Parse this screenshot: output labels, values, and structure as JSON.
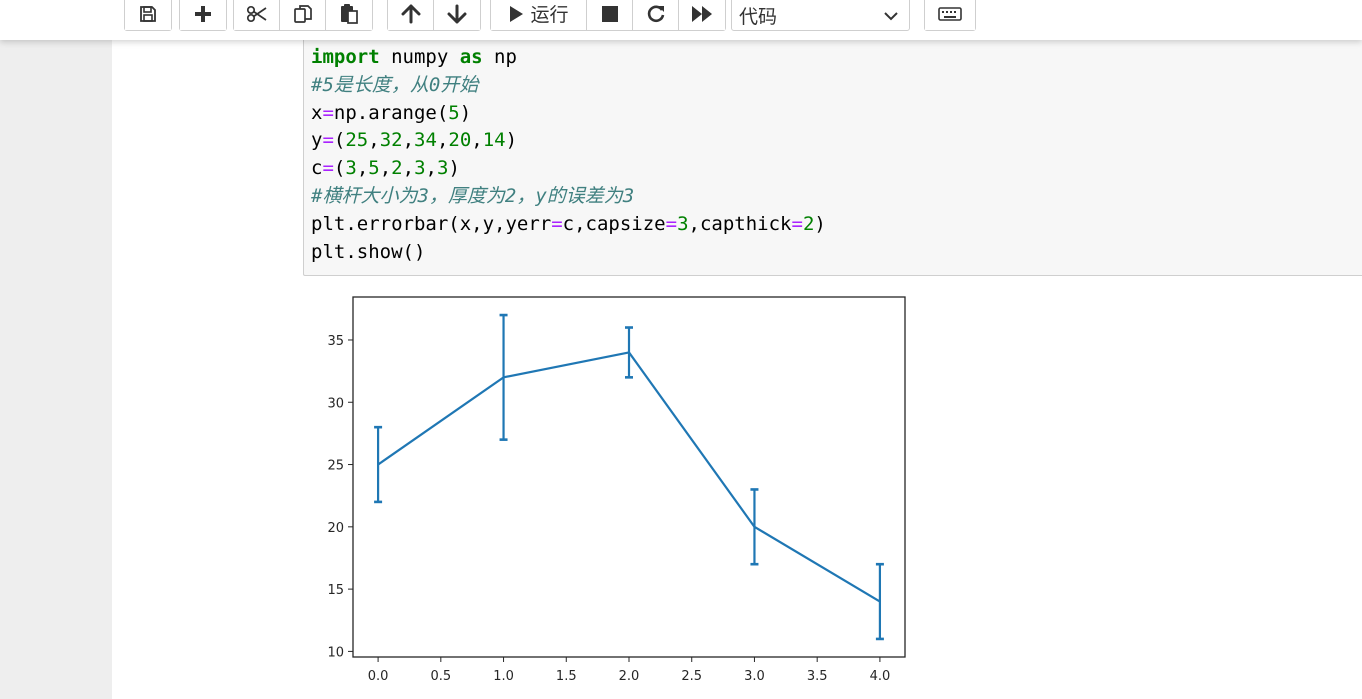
{
  "toolbar": {
    "groups": [
      [
        "save-icon"
      ],
      [
        "plus-icon"
      ],
      [
        "scissors-icon",
        "copy-icon",
        "paste-icon"
      ],
      [
        "arrow-up-icon",
        "arrow-down-icon"
      ],
      [
        "play-icon",
        "stop-icon",
        "restart-icon",
        "fast-forward-icon"
      ]
    ],
    "run_label": "运行",
    "cell_type_selected": "代码",
    "keyboard_icon": "keyboard-icon"
  },
  "code": {
    "lines": [
      "import numpy as np",
      "#5是长度，从0开始",
      "x=np.arange(5)",
      "y=(25,32,34,20,14)",
      "c=(3,5,2,3,3)",
      "#横杆大小为3，厚度为2，y的误差为3",
      "plt.errorbar(x,y,yerr=c,capsize=3,capthick=2)",
      "plt.show()"
    ]
  },
  "colors": {
    "series": "#1f77b4",
    "keyword": "#008000",
    "comment": "#408080",
    "operator": "#aa22ff",
    "number": "#008000"
  },
  "chart_data": {
    "type": "line",
    "x": [
      0,
      1,
      2,
      3,
      4
    ],
    "series": [
      {
        "values": [
          25,
          32,
          34,
          20,
          14
        ],
        "yerr": [
          3,
          5,
          2,
          3,
          3
        ]
      }
    ],
    "xlim": [
      -0.2,
      4.2
    ],
    "ylim": [
      9.55,
      38.45
    ],
    "xticks": [
      "0.0",
      "0.5",
      "1.0",
      "1.5",
      "2.0",
      "2.5",
      "3.0",
      "3.5",
      "4.0"
    ],
    "yticks": [
      "10",
      "15",
      "20",
      "25",
      "30",
      "35"
    ],
    "title": "",
    "xlabel": "",
    "ylabel": "",
    "grid": false
  }
}
